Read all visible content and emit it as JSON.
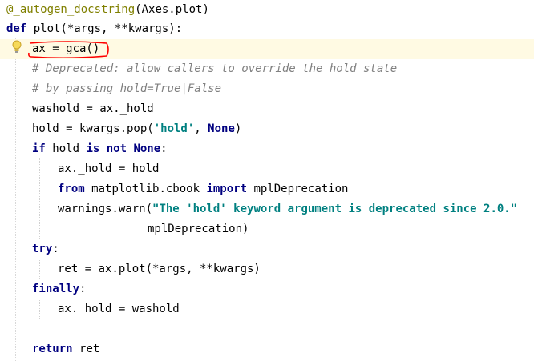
{
  "editor": {
    "lines": [
      [
        {
          "t": "deco",
          "v": "@_autogen_docstring"
        },
        {
          "t": "plain",
          "v": "(Axes.plot)"
        }
      ],
      [
        {
          "t": "kw",
          "v": "def "
        },
        {
          "t": "plain",
          "v": "plot(*args, **kwargs):"
        }
      ],
      [
        {
          "t": "plain",
          "v": "ax = gca()"
        }
      ],
      [
        {
          "t": "cmt",
          "v": "# Deprecated: allow callers to override the hold state"
        }
      ],
      [
        {
          "t": "cmt",
          "v": "# by passing hold=True|False"
        }
      ],
      [
        {
          "t": "plain",
          "v": "washold = ax._hold"
        }
      ],
      [
        {
          "t": "plain",
          "v": "hold = kwargs.pop("
        },
        {
          "t": "str",
          "v": "'hold'"
        },
        {
          "t": "plain",
          "v": ", "
        },
        {
          "t": "kw",
          "v": "None"
        },
        {
          "t": "plain",
          "v": ")"
        }
      ],
      [
        {
          "t": "kw",
          "v": "if "
        },
        {
          "t": "plain",
          "v": "hold "
        },
        {
          "t": "kw",
          "v": "is not None"
        },
        {
          "t": "plain",
          "v": ":"
        }
      ],
      [
        {
          "t": "plain",
          "v": "ax._hold = hold"
        }
      ],
      [
        {
          "t": "kw",
          "v": "from "
        },
        {
          "t": "plain",
          "v": "matplotlib.cbook "
        },
        {
          "t": "kw",
          "v": "import "
        },
        {
          "t": "plain",
          "v": "mplDeprecation"
        }
      ],
      [
        {
          "t": "plain",
          "v": "warnings.warn("
        },
        {
          "t": "str",
          "v": "\"The 'hold' keyword argument is deprecated since 2.0.\""
        }
      ],
      [
        {
          "t": "plain",
          "v": "mplDeprecation)"
        }
      ],
      [
        {
          "t": "kw",
          "v": "try"
        },
        {
          "t": "plain",
          "v": ":"
        }
      ],
      [
        {
          "t": "plain",
          "v": "ret = ax.plot(*args, **kwargs)"
        }
      ],
      [
        {
          "t": "kw",
          "v": "finally"
        },
        {
          "t": "plain",
          "v": ":"
        }
      ],
      [
        {
          "t": "plain",
          "v": "ax._hold = washold"
        }
      ],
      [],
      [
        {
          "t": "kw",
          "v": "return "
        },
        {
          "t": "plain",
          "v": "ret"
        }
      ]
    ],
    "current_line": 2,
    "annotation_color": "#ff0000",
    "intention_icon": "lightbulb-icon"
  }
}
